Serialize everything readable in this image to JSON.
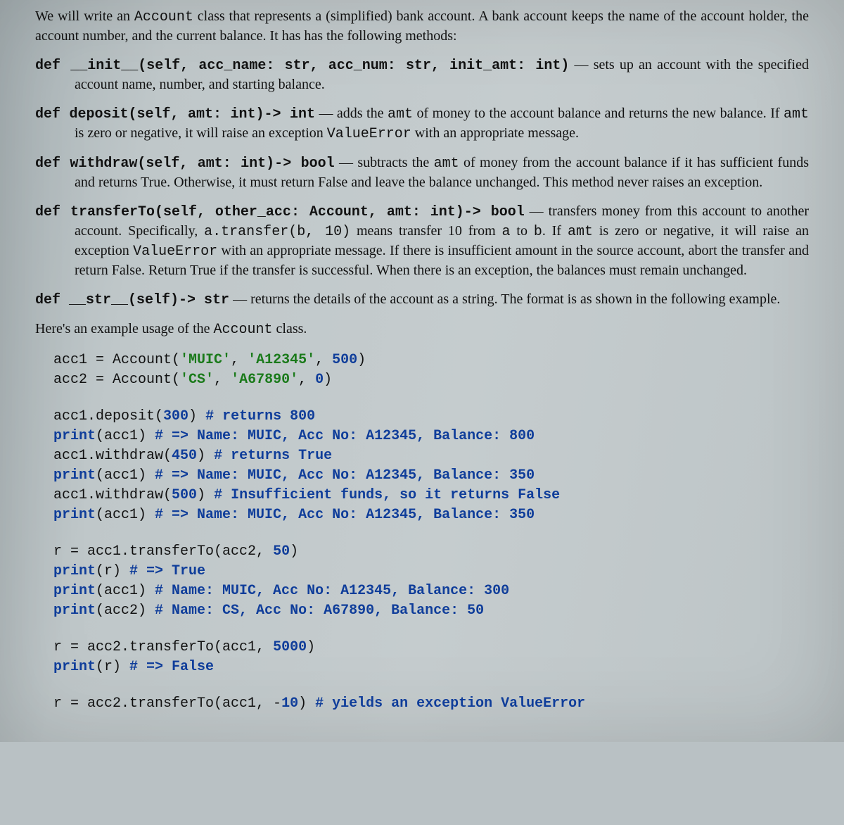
{
  "intro": {
    "prefix": "We will write an ",
    "acct_class": "Account",
    "rest": " class that represents a (simplified) bank account. A bank account keeps the name of the account holder, the account number, and the current balance. It has has the following methods:"
  },
  "methods": {
    "init": {
      "kw": "def",
      "sig": " __init__(self, acc_name: str, acc_num: str, init_amt: int)",
      "desc": " — sets up an account with the specified account name, number, and starting balance."
    },
    "deposit": {
      "kw": "def",
      "sig": " deposit(self, amt: int)-> int",
      "p1": " — adds the ",
      "tt_amt": "amt",
      "p2": " of money to the account balance and returns the new balance. If ",
      "p3": " is zero or negative, it will raise an exception ",
      "tt_err": "ValueError",
      "p4": " with an appropriate message."
    },
    "withdraw": {
      "kw": "def",
      "sig": " withdraw(self, amt: int)-> bool",
      "p1": " — subtracts the ",
      "tt_amt": "amt",
      "p2": " of money from the account balance if it has sufficient funds and returns True. Otherwise, it must return False and leave the balance unchanged. This method never raises an exception."
    },
    "transfer": {
      "kw": "def",
      "sig": " transferTo(self, other_acc: Account, amt: int)-> bool",
      "p1": " — transfers money from this account to another account.  Specifically, ",
      "tt_ex": "a.transfer(b, 10)",
      "p2": " means transfer 10 from ",
      "tt_a": "a",
      "p3": " to ",
      "tt_b": "b",
      "p4": ".  If ",
      "tt_amt": "amt",
      "p5": " is zero or negative, it will raise an exception ",
      "tt_err": "ValueError",
      "p6": " with an appropriate message.  If there is insufficient amount in the source account, abort the transfer and return False. Return True if the transfer is successful. When there is an exception, the balances must remain unchanged."
    },
    "str": {
      "kw": "def",
      "sig": " __str__(self)-> str",
      "desc": " — returns the details of the account as a string. The format is as shown in the following example."
    }
  },
  "example_intro": {
    "p1": "Here's an example usage of the ",
    "tt": "Account",
    "p2": " class."
  },
  "code1": {
    "l1a": "acc1 = Account(",
    "l1b": "'MUIC'",
    "l1c": ", ",
    "l1d": "'A12345'",
    "l1e": ", ",
    "l1f": "500",
    "l1g": ")",
    "l2a": "acc2 = Account(",
    "l2b": "'CS'",
    "l2c": ", ",
    "l2d": "'A67890'",
    "l2e": ", ",
    "l2f": "0",
    "l2g": ")"
  },
  "code2": {
    "l1a": "acc1.deposit(",
    "l1b": "300",
    "l1c": ") ",
    "l1d": "# returns 800",
    "l2a": "print",
    "l2b": "(acc1) ",
    "l2c": "# => Name: MUIC, Acc No: A12345, Balance: 800",
    "l3a": "acc1.withdraw(",
    "l3b": "450",
    "l3c": ") ",
    "l3d": "# returns True",
    "l4a": "print",
    "l4b": "(acc1) ",
    "l4c": "# => Name: MUIC, Acc No: A12345, Balance: 350",
    "l5a": "acc1.withdraw(",
    "l5b": "500",
    "l5c": ") ",
    "l5d": "# Insufficient funds, so it returns False",
    "l6a": "print",
    "l6b": "(acc1) ",
    "l6c": "# => Name: MUIC, Acc No: A12345, Balance: 350"
  },
  "code3": {
    "l1a": "r = acc1.transferTo(acc2, ",
    "l1b": "50",
    "l1c": ")",
    "l2a": "print",
    "l2b": "(r) ",
    "l2c": "# => True",
    "l3a": "print",
    "l3b": "(acc1) ",
    "l3c": "# Name: MUIC, Acc No: A12345, Balance: 300",
    "l4a": "print",
    "l4b": "(acc2) ",
    "l4c": "# Name: CS, Acc No: A67890, Balance: 50"
  },
  "code4": {
    "l1a": "r = acc2.transferTo(acc1, ",
    "l1b": "5000",
    "l1c": ")",
    "l2a": "print",
    "l2b": "(r) ",
    "l2c": "# => False"
  },
  "code5": {
    "l1a": "r = acc2.transferTo(acc1, -",
    "l1b": "10",
    "l1c": ") ",
    "l1d": "# yields an exception ValueError"
  }
}
